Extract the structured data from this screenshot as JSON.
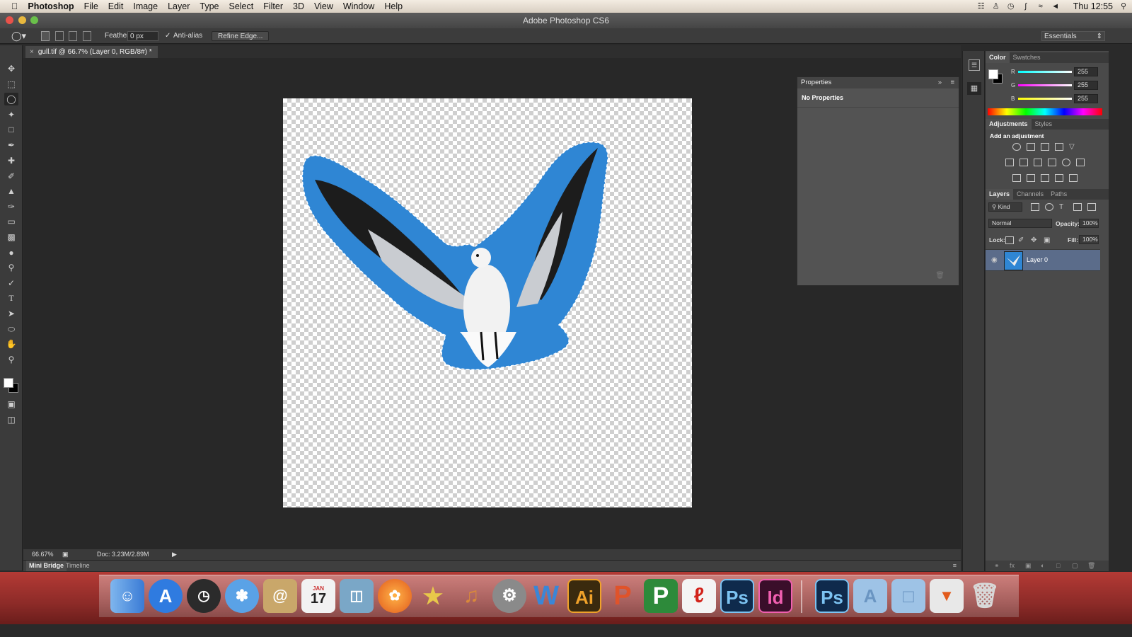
{
  "menubar": {
    "apple": "",
    "app": "Photoshop",
    "items": [
      "File",
      "Edit",
      "Image",
      "Layer",
      "Type",
      "Select",
      "Filter",
      "3D",
      "View",
      "Window",
      "Help"
    ],
    "clock": "Thu 12:55"
  },
  "window": {
    "title": "Adobe Photoshop CS6"
  },
  "options": {
    "feather_label": "Feather:",
    "feather_value": "0 px",
    "antialias_label": "Anti-alias",
    "antialias_checked": true,
    "refine_button": "Refine Edge...",
    "workspace": "Essentials"
  },
  "document": {
    "tab_title": "gull.tif @ 66.7% (Layer 0, RGB/8#) *",
    "zoom": "66.67%",
    "doc_size": "Doc: 3.23M/2.89M"
  },
  "bottom_tabs": [
    "Mini Bridge",
    "Timeline"
  ],
  "properties": {
    "title": "Properties",
    "body": "No Properties"
  },
  "color_panel": {
    "tabs": [
      "Color",
      "Swatches"
    ],
    "channels": [
      {
        "label": "R",
        "value": "255",
        "color": "#e33"
      },
      {
        "label": "G",
        "value": "255",
        "color": "#e3e"
      },
      {
        "label": "B",
        "value": "255",
        "color": "#ee3"
      }
    ]
  },
  "adjustments_panel": {
    "tabs": [
      "Adjustments",
      "Styles"
    ],
    "heading": "Add an adjustment"
  },
  "layers_panel": {
    "tabs": [
      "Layers",
      "Channels",
      "Paths"
    ],
    "filter": "Kind",
    "blend_mode": "Normal",
    "opacity_label": "Opacity:",
    "opacity": "100%",
    "lock_label": "Lock:",
    "fill_label": "Fill:",
    "fill": "100%",
    "layers": [
      {
        "name": "Layer 0",
        "visible": true,
        "selected": true
      }
    ]
  },
  "colors": {
    "selection_fill": "#2f86d4",
    "panel_bg": "#4a4a4a",
    "layer_selected": "#5b6c8a"
  },
  "dock": {
    "icons": [
      "finder-icon",
      "app-store-icon",
      "dashboard-icon",
      "safari-icon",
      "address-book-icon",
      "calendar-icon",
      "preview-icon",
      "firefox-icon",
      "imovie-icon",
      "garageband-icon",
      "system-preferences-icon",
      "word-icon",
      "illustrator-icon",
      "powerpoint-icon",
      "project-icon",
      "acrobat-icon",
      "photoshop-icon",
      "indesign-icon",
      "photoshop-doc-icon",
      "applications-folder-icon",
      "documents-folder-icon",
      "downloads-stack-icon",
      "trash-icon"
    ],
    "labels": {
      "calendar_day": "17",
      "calendar_month": "JAN",
      "word": "W",
      "illustrator": "Ai",
      "photoshop": "Ps",
      "indesign": "Id",
      "photoshop2": "Ps"
    }
  }
}
